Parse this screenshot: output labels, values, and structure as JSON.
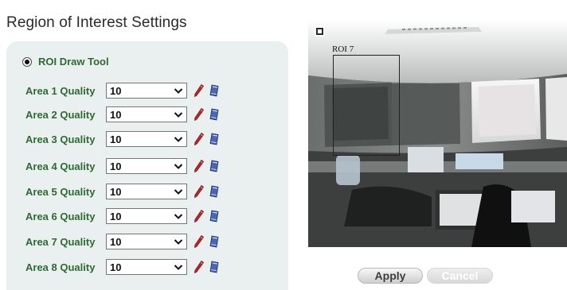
{
  "page": {
    "title": "Region of Interest Settings"
  },
  "roi_tool": {
    "label": "ROI Draw Tool",
    "selected": true
  },
  "areas": [
    {
      "label": "Area 1 Quality",
      "value": "10"
    },
    {
      "label": "Area 2 Quality",
      "value": "10"
    },
    {
      "label": "Area 3 Quality",
      "value": "10"
    },
    {
      "label": "Area 4 Quality",
      "value": "10"
    },
    {
      "label": "Area 5 Quality",
      "value": "10"
    },
    {
      "label": "Area 6 Quality",
      "value": "10"
    },
    {
      "label": "Area 7 Quality",
      "value": "10"
    },
    {
      "label": "Area 8 Quality",
      "value": "10"
    }
  ],
  "preview": {
    "roi_label": "ROI 7"
  },
  "buttons": {
    "apply": "Apply",
    "cancel": "Cancel"
  },
  "icons": {
    "draw": "pencil-icon",
    "clear": "eraser-icon",
    "dropdown": "chevron-down-icon",
    "roi_toggle": "roi-toggle-icon"
  },
  "colors": {
    "label_green": "#2e6a32",
    "panel_background": "#e9f0ef",
    "pencil_red": "#c62828",
    "eraser_blue": "#4b67b3"
  }
}
